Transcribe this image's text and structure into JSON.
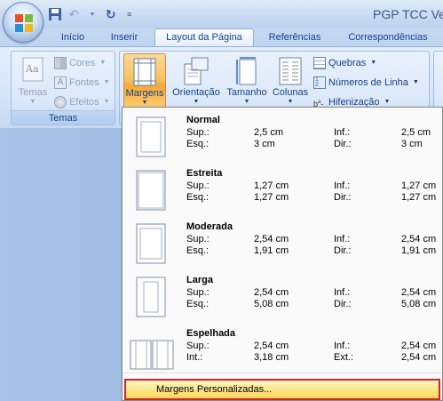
{
  "window": {
    "title": "PGP TCC Ver"
  },
  "tabs": [
    {
      "label": "Início"
    },
    {
      "label": "Inserir"
    },
    {
      "label": "Layout da Página"
    },
    {
      "label": "Referências"
    },
    {
      "label": "Correspondências"
    }
  ],
  "ribbon": {
    "temas_group": {
      "label": "Temas",
      "temas_button": "Temas",
      "cores": "Cores",
      "fontes": "Fontes",
      "efeitos": "Efeitos"
    },
    "page_setup": {
      "margens": "Margens",
      "orientacao": "Orientação",
      "tamanho": "Tamanho",
      "colunas": "Colunas",
      "quebras": "Quebras",
      "numeros_linha": "Números de Linha",
      "hifenizacao": "Hifenização"
    }
  },
  "margins_menu": {
    "items": [
      {
        "name": "Normal",
        "r1l": "Sup.:",
        "r1v": "2,5 cm",
        "r1l2": "Inf.:",
        "r1v2": "2,5 cm",
        "r2l": "Esq.:",
        "r2v": "3 cm",
        "r2l2": "Dir.:",
        "r2v2": "3 cm"
      },
      {
        "name": "Estreita",
        "r1l": "Sup.:",
        "r1v": "1,27 cm",
        "r1l2": "Inf.:",
        "r1v2": "1,27 cm",
        "r2l": "Esq.:",
        "r2v": "1,27 cm",
        "r2l2": "Dir.:",
        "r2v2": "1,27 cm"
      },
      {
        "name": "Moderada",
        "r1l": "Sup.:",
        "r1v": "2,54 cm",
        "r1l2": "Inf.:",
        "r1v2": "2,54 cm",
        "r2l": "Esq.:",
        "r2v": "1,91 cm",
        "r2l2": "Dir.:",
        "r2v2": "1,91 cm"
      },
      {
        "name": "Larga",
        "r1l": "Sup.:",
        "r1v": "2,54 cm",
        "r1l2": "Inf.:",
        "r1v2": "2,54 cm",
        "r2l": "Esq.:",
        "r2v": "5,08 cm",
        "r2l2": "Dir.:",
        "r2v2": "5,08 cm"
      },
      {
        "name": "Espelhada",
        "r1l": "Sup.:",
        "r1v": "2,54 cm",
        "r1l2": "Inf.:",
        "r1v2": "2,54 cm",
        "r2l": "Int.:",
        "r2v": "3,18 cm",
        "r2l2": "Ext.:",
        "r2v2": "2,54 cm"
      }
    ],
    "custom_label": "Margens Personalizadas..."
  },
  "colors": {
    "highlight_border": "#d2232a",
    "pressed_button": "#fbc05d",
    "ribbon_text": "#15428b"
  }
}
